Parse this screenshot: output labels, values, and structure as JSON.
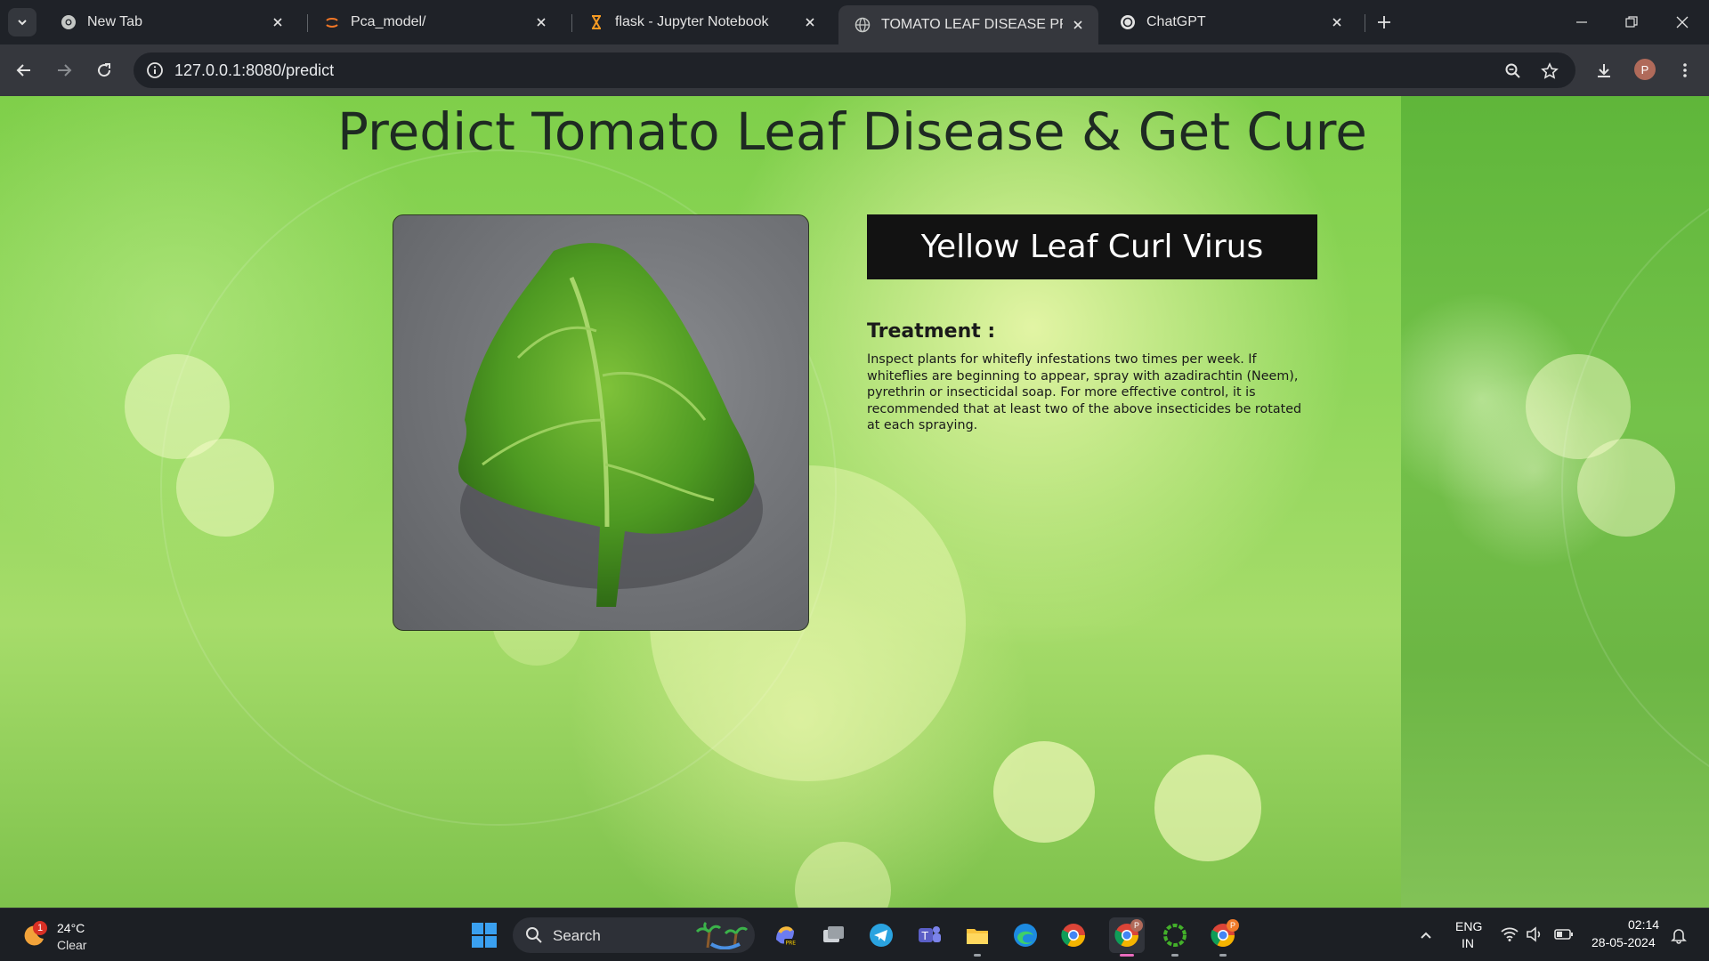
{
  "browser": {
    "tabs": [
      {
        "title": "New Tab",
        "icon": "chrome-icon"
      },
      {
        "title": "Pca_model/",
        "icon": "jupyter-icon"
      },
      {
        "title": "flask - Jupyter Notebook",
        "icon": "hourglass-icon"
      },
      {
        "title": "TOMATO LEAF DISEASE PREDIC",
        "icon": "globe-icon"
      },
      {
        "title": "ChatGPT",
        "icon": "openai-icon"
      }
    ],
    "url": "127.0.0.1:8080/predict",
    "profile_initial": "P"
  },
  "page": {
    "title": "Predict Tomato Leaf Disease & Get Cure",
    "prediction": "Yellow Leaf Curl Virus",
    "treatment_heading": "Treatment :",
    "treatment_text": "Inspect plants for whitefly infestations two times per week. If whiteflies are beginning to appear, spray with azadirachtin (Neem), pyrethrin or insecticidal soap. For more effective control, it is recommended that at least two of the above insecticides be rotated at each spraying."
  },
  "taskbar": {
    "weather_badge": "1",
    "temperature": "24°C",
    "condition": "Clear",
    "search_label": "Search",
    "language": "ENG",
    "region": "IN",
    "time": "02:14",
    "date": "28-05-2024",
    "chrome_badge_1": "P",
    "chrome_badge_2": "P"
  },
  "colors": {
    "accent": "#8ad34f",
    "result_bg": "#121212"
  }
}
